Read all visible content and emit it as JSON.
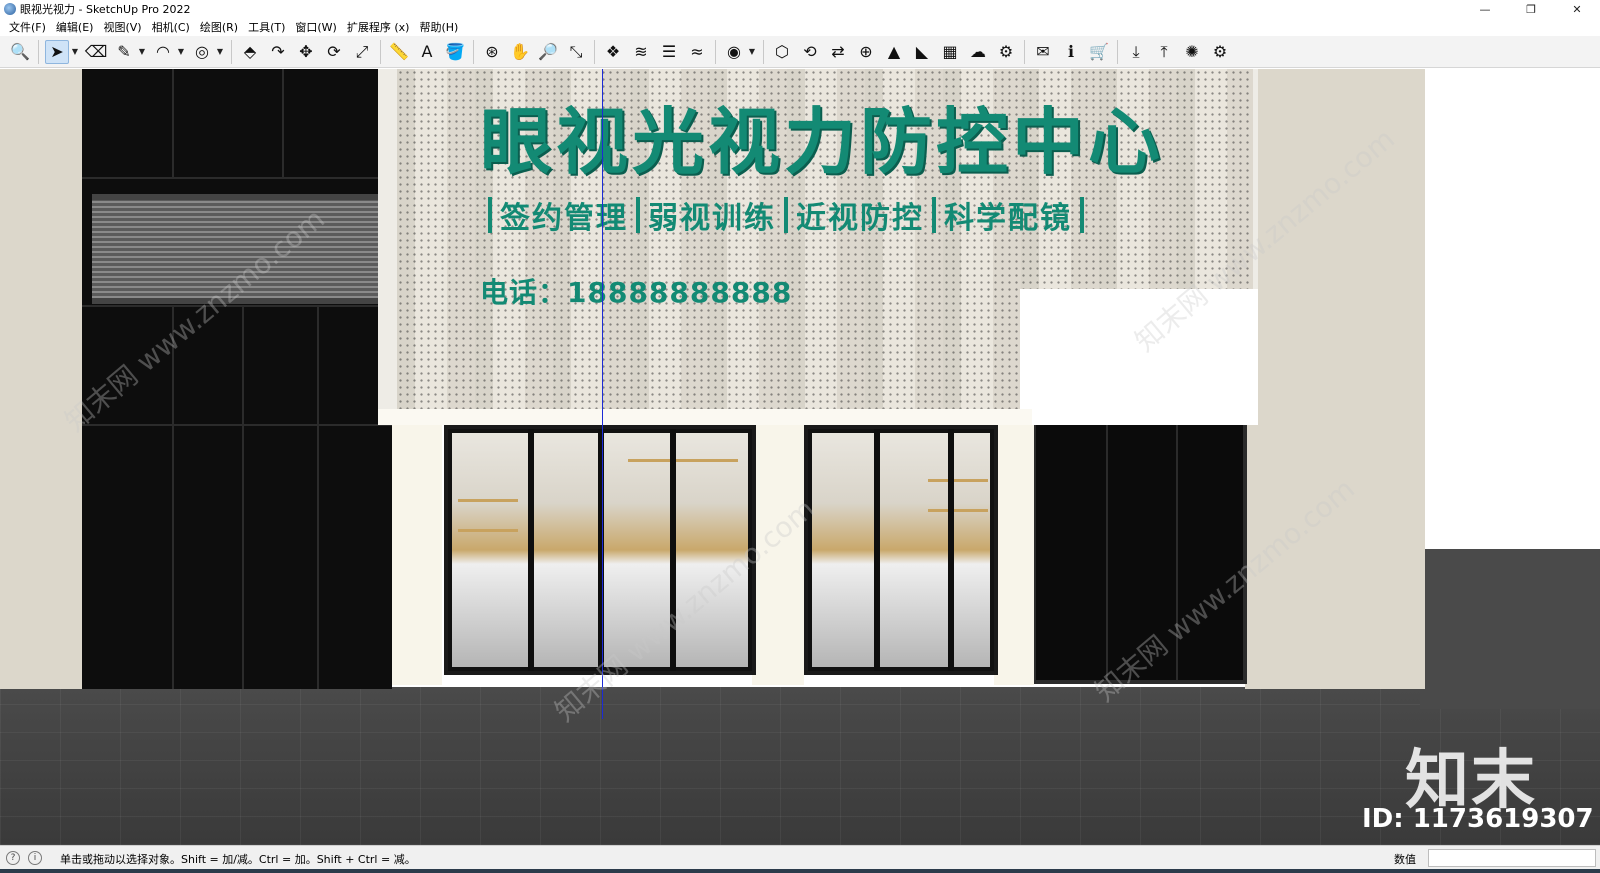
{
  "window": {
    "title": "眼视光视力 - SketchUp Pro 2022",
    "controls": [
      "—",
      "❐",
      "✕"
    ]
  },
  "menu": [
    "文件(F)",
    "编辑(E)",
    "视图(V)",
    "相机(C)",
    "绘图(R)",
    "工具(T)",
    "窗口(W)",
    "扩展程序 (x)",
    "帮助(H)"
  ],
  "toolbar": {
    "tools": [
      {
        "name": "zoom-extents",
        "glyph": "🔍"
      },
      {
        "name": "select",
        "glyph": "➤",
        "active": true
      },
      {
        "name": "eraser",
        "glyph": "⌫"
      },
      {
        "name": "pencil",
        "glyph": "✎"
      },
      {
        "name": "arc",
        "glyph": "◠"
      },
      {
        "name": "shapes",
        "glyph": "◎"
      },
      {
        "name": "push-pull",
        "glyph": "⬘"
      },
      {
        "name": "follow-me",
        "glyph": "↷"
      },
      {
        "name": "move",
        "glyph": "✥"
      },
      {
        "name": "rotate",
        "glyph": "⟳"
      },
      {
        "name": "scale",
        "glyph": "⤢"
      },
      {
        "name": "tape-measure",
        "glyph": "📏"
      },
      {
        "name": "text",
        "glyph": "A"
      },
      {
        "name": "paint-bucket",
        "glyph": "🪣"
      },
      {
        "name": "orbit",
        "glyph": "⊛"
      },
      {
        "name": "pan",
        "glyph": "✋"
      },
      {
        "name": "zoom",
        "glyph": "🔎"
      },
      {
        "name": "zoom-window",
        "glyph": "⤡"
      },
      {
        "name": "layers-a",
        "glyph": "❖"
      },
      {
        "name": "layers-b",
        "glyph": "≋"
      },
      {
        "name": "layers-c",
        "glyph": "☰"
      },
      {
        "name": "layers-d",
        "glyph": "≈"
      },
      {
        "name": "account",
        "glyph": "◉"
      },
      {
        "name": "ext-warehouse",
        "glyph": "⬡"
      },
      {
        "name": "ext-sync",
        "glyph": "⟲"
      },
      {
        "name": "ext-flip",
        "glyph": "⇄"
      },
      {
        "name": "ext-add",
        "glyph": "⊕"
      },
      {
        "name": "ext-tree",
        "glyph": "▲"
      },
      {
        "name": "ext-stairs",
        "glyph": "◣"
      },
      {
        "name": "ext-checker",
        "glyph": "▦"
      },
      {
        "name": "ext-cloud",
        "glyph": "☁"
      },
      {
        "name": "ext-settings",
        "glyph": "⚙"
      },
      {
        "name": "mail",
        "glyph": "✉"
      },
      {
        "name": "info",
        "glyph": "ℹ"
      },
      {
        "name": "cart",
        "glyph": "🛒"
      },
      {
        "name": "ext-import",
        "glyph": "⤓"
      },
      {
        "name": "ext-export",
        "glyph": "⤒"
      },
      {
        "name": "ext-render",
        "glyph": "✺"
      },
      {
        "name": "ext-gear2",
        "glyph": "⚙"
      }
    ]
  },
  "sign": {
    "title": "眼视光视力防控中心",
    "services": [
      "签约管理",
      "弱视训练",
      "近视防控",
      "科学配镜"
    ],
    "phone": "电话：18888888888"
  },
  "watermark": {
    "text": "知末网 www.znzmo.com",
    "logo": "知末",
    "id": "ID: 1173619307"
  },
  "status": {
    "message": "单击或拖动以选择对象。Shift = 加/减。Ctrl = 加。Shift + Ctrl = 减。",
    "measurements_label": "数值",
    "measurements_value": ""
  },
  "colors": {
    "sign_green": "#138a74",
    "selection_blue": "#cfe3f7"
  }
}
